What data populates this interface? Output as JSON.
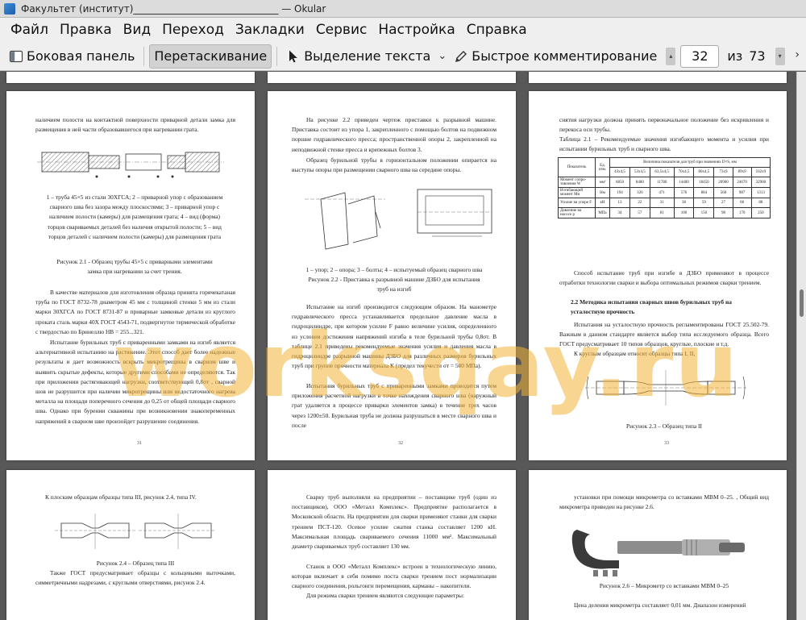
{
  "window": {
    "title": "Факультет (институт)______________________________ — Okular"
  },
  "menu": [
    "Файл",
    "Правка",
    "Вид",
    "Переход",
    "Закладки",
    "Сервис",
    "Настройка",
    "Справка"
  ],
  "toolbar": {
    "sidebar": "Боковая панель",
    "drag": "Перетаскивание",
    "text_select": "Выделение текста",
    "quick_annot": "Быстрое комментирование",
    "current_page": "32",
    "of": "из",
    "total_pages": "73"
  },
  "watermark": "worksqay.ru",
  "pages": {
    "p51": {
      "top": "наличием полости на контактной поверхности приварной детали замка для размещения в ней части образовавшегося при нагревании грата.",
      "legend": "1 – труба 45×5 из стали 30ХГСА; 2 – приварной упор с образованием сварного шва без зазора между плоскостями; 3 – приварной упор с наличием полости (камеры) для размещения грата; 4 – вид (форма) торцов свариваемых деталей без наличия открытой полости; 5 – вид торцов деталей с наличием полости (камеры) для размещения грата",
      "caption": "Рисунок 2.1 - Образец трубы 45×5 с приварными элементами замка при нагревании за счет трения.",
      "para1": "В качестве материалов для изготовления образца принята горячекатаная труба по ГОСТ 8732-78 диаметром 45 мм с толщиной стенки 5 мм из стали марки 30ХГСА по ГОСТ 8731-87 и приварные замковые детали из круглого проката сталь марки 40Х ГОСТ 4543-71, подвергнутое термической обработке с твердостью по Бринеллю НВ = 255...321.",
      "para2": "Испытание бурильных труб с приваренными замками на изгиб является альтернативной испытанию на растяжение. Этот способ дает более надежные результаты и дает возможность вскрыть микротрещины в сварном шве и выявить скрытые дефекты, которые другими способами не определяются. Так при приложении растягивающей нагрузки, соответствующей 0,8σт , сварной шов не разрушится при наличии микротрещины или недостаточного нагрева металла на площади поперечного сечения до 0,25 от общей площади сварного шва. Однако при бурении скважины при возникновении знакопеременных напряжений в сварном шве произойдет разрушение соединения.",
      "num": "31"
    },
    "p52": {
      "para1": "На рисунке 2.2 приведен чертеж приставки к разрывной машине. Приставка состоит из упора 1, закрепленного с помощью болтов на подвижном поршне гидравлического пресса; пространственной опоры 2, закрепленной на неподвижной стенке пресса и крепежных болтов 3.",
      "para2": "Образец бурильной трубы в горизонтальном положении опирается на выступы опоры при размещении сварного шва на середине опоры.",
      "legend": "1 – упор; 2 – опора; 3 – болты; 4 – испытуемый образец сварного шва",
      "caption": "Рисунок 2.2 - Приставка к разрывной машине ДЗБО для испытания труб на изгиб",
      "para3": "Испытание на изгиб производится следующим образом. На манометре гидравлического пресса устанавливается предельное давление масла в гидроцилиндре, при котором усилие F равно величине усилия, определенного из условия достижения напряжений изгиба в теле бурильной трубы 0,8σт. В таблице 2.1 приведены рекомендуемые значения усилия и давления масла в гидроцилиндре разрывной машины ДЗБО для различных размеров бурильных труб при группе прочности материала К (предел текучести σт = 500 МПа).",
      "para4": "Испытания бурильных труб с приваренными замками проводятся путем приложения расчетной нагрузки в точке нахождения сварного шва (наружный грат удаляется в процессе приварки элементов замка) в течение трех часов через 1200±50. Бурильная труба не должна разрушаться в месте сварного шва и после",
      "num": "32"
    },
    "p53": {
      "top": "снятия нагрузки должна принять первоначальное положение без искривления и перекоса оси трубы.",
      "table_caption": "Таблица 2.1 – Рекомендуемые значения изгибающего момента и усилия при испытании бурильных труб и сварного шва.",
      "table_header": [
        "Показатель",
        "Ед. изм.",
        "Величина показателя для труб при значениях D×S, мм"
      ],
      "table_sizes": [
        "43х4,5",
        "53х4,5",
        "63,5х4,5",
        "70х4,5",
        "80х4,5",
        "73х9",
        "89х9",
        "102х9"
      ],
      "table_rows": [
        [
          "Момент сопро-тивления W",
          "мм³",
          "6850",
          "8480",
          "11780",
          "14400",
          "18450",
          "20900",
          "24670",
          "32900"
        ],
        [
          "Изгибающий момент Ми",
          "Нм",
          "194",
          "326",
          "471",
          "576",
          "884",
          "560",
          "987",
          "1313"
        ],
        [
          "Усилие на упоре F",
          "кН",
          "13",
          "22",
          "31",
          "38",
          "59",
          "27",
          "66",
          "88"
        ],
        [
          "Давление на насосе р",
          "МПа",
          "34",
          "57",
          "81",
          "100",
          "150",
          "98",
          "170",
          "250"
        ]
      ],
      "para1": "Способ испытание труб при изгибе в ДЗБО применяют в процессе отработки технологии сварки и выбора оптимальных режимов сварки трением.",
      "heading": "2.2 Методика испытания сварных швов бурильных труб на усталостную прочность",
      "para2": "Испытания на усталостную прочность регламентированы ГОСТ 25.502-79. Важным в данном стандарте является выбор типа исследуемого образца. Всего ГОСТ предусматривает 10 типов образцов, круглые, плоские и т.д.",
      "para3": "К круглым образцам относят образцы типа I, II,",
      "caption": "Рисунок 2.3 – Образец типа II",
      "num": "33"
    },
    "p54": {
      "top": "К плоским образцам образцы типа III, рисунок 2.4, типа IV.",
      "caption": "Рисунок 2.4 – Образец типа III",
      "para": "Также ГОСТ предусматривает образцы с кольцевыми выточками, симметричными надрезами, с круглыми отверстиями, рисунок 2.4."
    },
    "p55": {
      "para1": "Сварку труб выполняли на предприятии – поставщике труб (один из поставщиков), ООО «Металл Комплекс». Предприятие располагается в Московской области. На предприятии для сварки применяют станки для сварки трением ПСТ-120. Осевое усилие сжатия станка составляет 1200 кН. Максимальная площадь свариваемого сечения 11000 мм². Максимальный диаметр свариваемых труб составляет 130 мм.",
      "para2": "Станок в ООО «Металл Комплекс» встроен в технологическую линию, которая включает в себя помимо поста сварки трением пост нормализации сварного соединения, рольгонги перемещения, карманы – накопители.",
      "para3": "Для режима сварки трением являются следующие параметры:"
    },
    "p56": {
      "top": "установки при помощи микрометра со вставками МВМ 0–25. , Общий вид микрометра приведен на рисунке 2.6.",
      "caption": "Рисунок 2.6 – Микрометр со вставками МВМ 0–25",
      "bottom": "Цена деления микрометра составляет 0,01 мм. Диапазон измерений"
    }
  }
}
